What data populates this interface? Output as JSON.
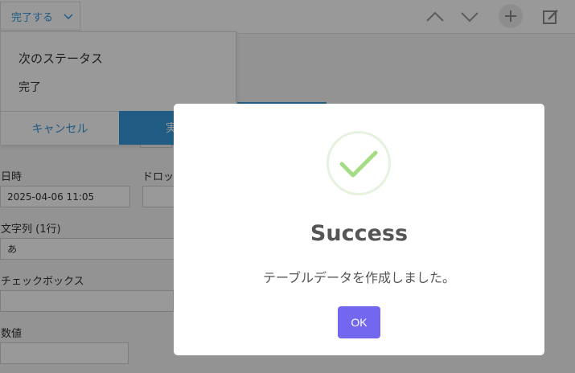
{
  "toolbar": {
    "status_button_label": "完了する",
    "icons": [
      "chevron-up-icon",
      "chevron-down-icon",
      "plus-icon",
      "edit-icon"
    ]
  },
  "dropdown": {
    "title": "次のステータス",
    "option": "完了",
    "cancel_label": "キャンセル",
    "execute_label": "実"
  },
  "form": {
    "datetime_label": "日時",
    "datetime_value": "2025-04-06 11:05",
    "dropdown_label": "ドロッ",
    "text_label": "文字列 (1行)",
    "text_value": "あ",
    "checkbox_label": "チェックボックス",
    "number_label": "数値"
  },
  "modal": {
    "title": "Success",
    "message": "テーブルデータを作成しました。",
    "ok_label": "OK",
    "accent_color": "#7367f0",
    "success_color": "#a5dc86"
  }
}
